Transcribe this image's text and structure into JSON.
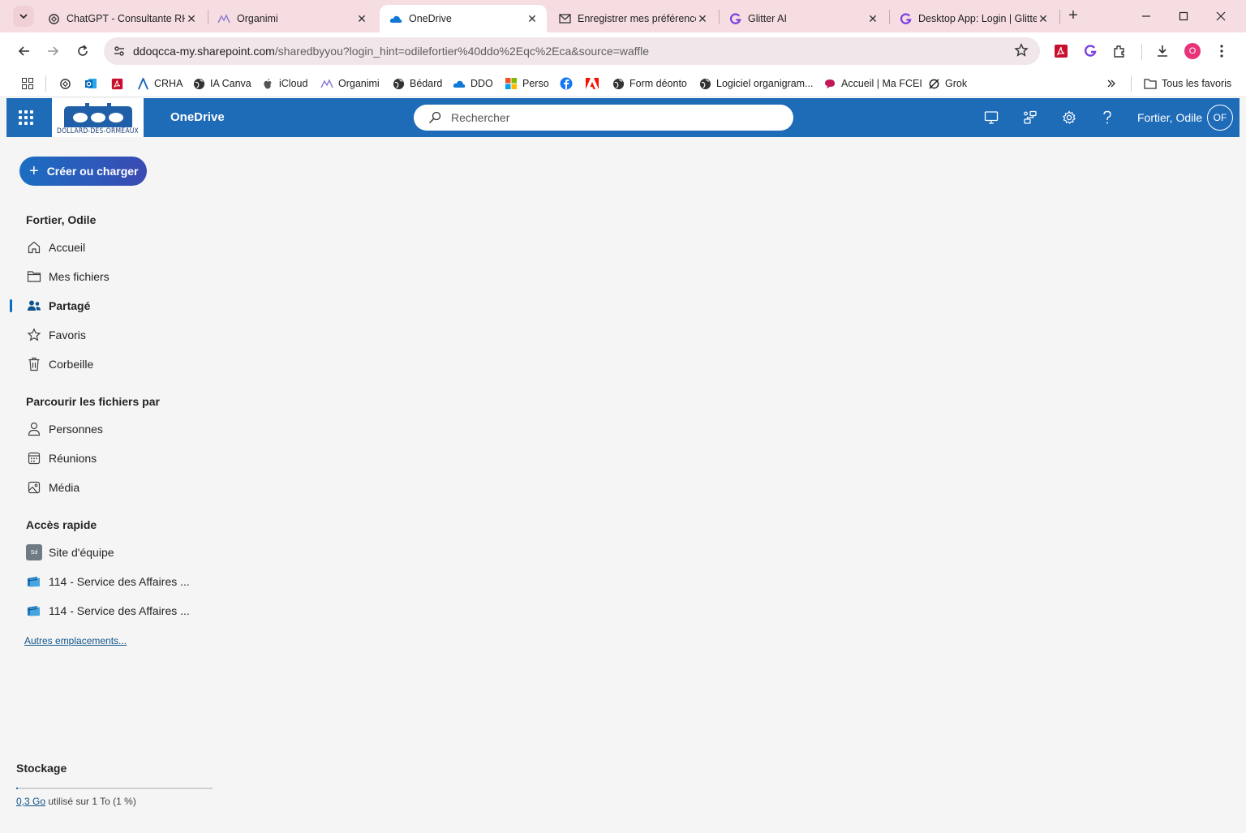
{
  "browser": {
    "tabs": [
      {
        "title": "ChatGPT - Consultante RH",
        "icon": "chatgpt-icon"
      },
      {
        "title": "Organimi",
        "icon": "organimi-icon"
      },
      {
        "title": "OneDrive",
        "icon": "onedrive-icon",
        "active": true
      },
      {
        "title": "Enregistrer mes préférences",
        "icon": "mail-icon"
      },
      {
        "title": "Glitter AI",
        "icon": "glitter-icon"
      },
      {
        "title": "Desktop App: Login | Glitter",
        "icon": "glitter-icon"
      }
    ],
    "url_host": "ddoqcca-my.sharepoint.com",
    "url_path": "/sharedbyyou?login_hint=odilefortier%40ddo%2Eqc%2Eca&source=waffle",
    "profile_initial": "O",
    "bookmarks": [
      {
        "label": "",
        "icon": "chatgpt-icon"
      },
      {
        "label": "",
        "icon": "outlook-icon"
      },
      {
        "label": "",
        "icon": "pdf-icon"
      },
      {
        "label": "CRHA",
        "icon": "crha-icon"
      },
      {
        "label": "IA Canva",
        "icon": "globe-icon"
      },
      {
        "label": "iCloud",
        "icon": "apple-icon"
      },
      {
        "label": "Organimi",
        "icon": "organimi-icon"
      },
      {
        "label": "Bédard",
        "icon": "globe-icon"
      },
      {
        "label": "DDO",
        "icon": "onedrive-icon"
      },
      {
        "label": "Perso",
        "icon": "microsoft-icon"
      },
      {
        "label": "",
        "icon": "facebook-icon"
      },
      {
        "label": "",
        "icon": "adobe-icon"
      },
      {
        "label": "Form déonto",
        "icon": "globe-icon"
      },
      {
        "label": "Logiciel organigram...",
        "icon": "globe-icon"
      },
      {
        "label": "Accueil | Ma FCEI",
        "icon": "fcei-icon"
      },
      {
        "label": "Grok",
        "icon": "grok-icon"
      }
    ],
    "all_bookmarks": "Tous les favoris"
  },
  "header": {
    "logo_text": "DOLLARD-DES-ORMEAUX",
    "app_name": "OneDrive",
    "search_placeholder": "Rechercher",
    "user_name": "Fortier, Odile",
    "user_initials": "OF"
  },
  "nav": {
    "create_label": "Créer ou charger",
    "owner_heading": "Fortier, Odile",
    "items": [
      {
        "label": "Accueil",
        "icon": "home-icon"
      },
      {
        "label": "Mes fichiers",
        "icon": "folder-icon"
      },
      {
        "label": "Partagé",
        "icon": "people-icon",
        "selected": true
      },
      {
        "label": "Favoris",
        "icon": "star-icon"
      },
      {
        "label": "Corbeille",
        "icon": "trash-icon"
      }
    ],
    "browse_heading": "Parcourir les fichiers par",
    "browse_items": [
      {
        "label": "Personnes",
        "icon": "person-icon"
      },
      {
        "label": "Réunions",
        "icon": "calendar-icon"
      },
      {
        "label": "Média",
        "icon": "image-icon"
      }
    ],
    "quick_heading": "Accès rapide",
    "quick_items": [
      {
        "label": "Site d'équipe",
        "badge": "Sd"
      },
      {
        "label": "114 - Service des Affaires ...",
        "icon": "library-icon"
      },
      {
        "label": "114 - Service des Affaires ...",
        "icon": "library-icon"
      }
    ],
    "more_link": "Autres emplacements..."
  },
  "storage": {
    "title": "Stockage",
    "used": "0,3 Go",
    "rest": " utilisé sur 1 To (1 %)",
    "percent": 1
  }
}
